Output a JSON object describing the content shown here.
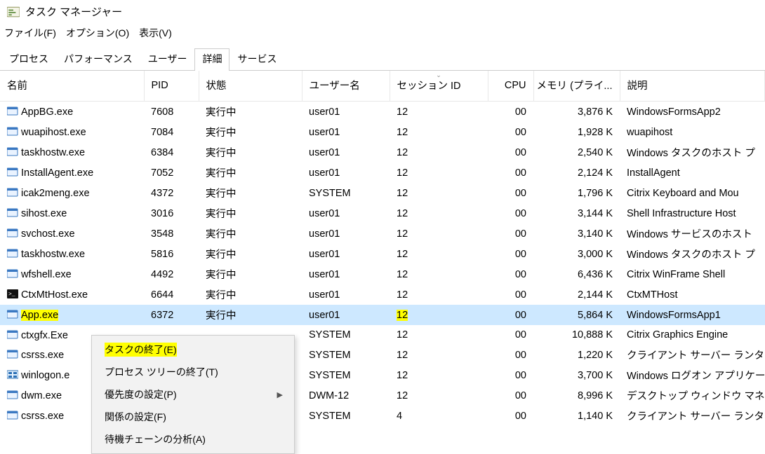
{
  "window": {
    "title": "タスク マネージャー"
  },
  "menu": {
    "file": "ファイル(F)",
    "options": "オプション(O)",
    "view": "表示(V)"
  },
  "tabs": {
    "processes": "プロセス",
    "performance": "パフォーマンス",
    "users": "ユーザー",
    "details": "詳細",
    "services": "サービス"
  },
  "columns": {
    "name": "名前",
    "pid": "PID",
    "status": "状態",
    "user": "ユーザー名",
    "session": "セッション ID",
    "cpu": "CPU",
    "memory": "メモリ (プライ...",
    "description": "説明"
  },
  "rows": [
    {
      "name": "AppBG.exe",
      "pid": "7608",
      "status": "実行中",
      "user": "user01",
      "session": "12",
      "cpu": "00",
      "memory": "3,876 K",
      "desc": "WindowsFormsApp2",
      "icon": "app"
    },
    {
      "name": "wuapihost.exe",
      "pid": "7084",
      "status": "実行中",
      "user": "user01",
      "session": "12",
      "cpu": "00",
      "memory": "1,928 K",
      "desc": "wuapihost",
      "icon": "app"
    },
    {
      "name": "taskhostw.exe",
      "pid": "6384",
      "status": "実行中",
      "user": "user01",
      "session": "12",
      "cpu": "00",
      "memory": "2,540 K",
      "desc": "Windows タスクのホスト プ",
      "icon": "app"
    },
    {
      "name": "InstallAgent.exe",
      "pid": "7052",
      "status": "実行中",
      "user": "user01",
      "session": "12",
      "cpu": "00",
      "memory": "2,124 K",
      "desc": "InstallAgent",
      "icon": "app"
    },
    {
      "name": "icak2meng.exe",
      "pid": "4372",
      "status": "実行中",
      "user": "SYSTEM",
      "session": "12",
      "cpu": "00",
      "memory": "1,796 K",
      "desc": "Citrix Keyboard and Mou",
      "icon": "app"
    },
    {
      "name": "sihost.exe",
      "pid": "3016",
      "status": "実行中",
      "user": "user01",
      "session": "12",
      "cpu": "00",
      "memory": "3,144 K",
      "desc": "Shell Infrastructure Host",
      "icon": "app"
    },
    {
      "name": "svchost.exe",
      "pid": "3548",
      "status": "実行中",
      "user": "user01",
      "session": "12",
      "cpu": "00",
      "memory": "3,140 K",
      "desc": "Windows サービスのホスト ",
      "icon": "app"
    },
    {
      "name": "taskhostw.exe",
      "pid": "5816",
      "status": "実行中",
      "user": "user01",
      "session": "12",
      "cpu": "00",
      "memory": "3,000 K",
      "desc": "Windows タスクのホスト プ",
      "icon": "app"
    },
    {
      "name": "wfshell.exe",
      "pid": "4492",
      "status": "実行中",
      "user": "user01",
      "session": "12",
      "cpu": "00",
      "memory": "6,436 K",
      "desc": "Citrix WinFrame Shell",
      "icon": "app"
    },
    {
      "name": "CtxMtHost.exe",
      "pid": "6644",
      "status": "実行中",
      "user": "user01",
      "session": "12",
      "cpu": "00",
      "memory": "2,144 K",
      "desc": "CtxMTHost",
      "icon": "cmd"
    },
    {
      "name": "App.exe",
      "pid": "6372",
      "status": "実行中",
      "user": "user01",
      "session": "12",
      "cpu": "00",
      "memory": "5,864 K",
      "desc": "WindowsFormsApp1",
      "icon": "app",
      "selected": true,
      "hlName": true,
      "hlSession": true
    },
    {
      "name": "ctxgfx.Exe",
      "pid": "",
      "status": "",
      "user": "SYSTEM",
      "session": "12",
      "cpu": "00",
      "memory": "10,888 K",
      "desc": "Citrix Graphics Engine",
      "icon": "app"
    },
    {
      "name": "csrss.exe",
      "pid": "",
      "status": "",
      "user": "SYSTEM",
      "session": "12",
      "cpu": "00",
      "memory": "1,220 K",
      "desc": "クライアント サーバー ランタイム",
      "icon": "app"
    },
    {
      "name": "winlogon.e",
      "pid": "",
      "status": "",
      "user": "SYSTEM",
      "session": "12",
      "cpu": "00",
      "memory": "3,700 K",
      "desc": "Windows ログオン アプリケー",
      "icon": "winlogon"
    },
    {
      "name": "dwm.exe",
      "pid": "",
      "status": "",
      "user": "DWM-12",
      "session": "12",
      "cpu": "00",
      "memory": "8,996 K",
      "desc": "デスクトップ ウィンドウ マネージ",
      "icon": "app"
    },
    {
      "name": "csrss.exe",
      "pid": "",
      "status": "",
      "user": "SYSTEM",
      "session": "4",
      "cpu": "00",
      "memory": "1,140 K",
      "desc": "クライアント サーバー ランタイム",
      "icon": "app"
    }
  ],
  "context_menu": {
    "end_task": "タスクの終了(E)",
    "end_tree": "プロセス ツリーの終了(T)",
    "priority": "優先度の設定(P)",
    "affinity": "関係の設定(F)",
    "analyze": "待機チェーンの分析(A)"
  }
}
